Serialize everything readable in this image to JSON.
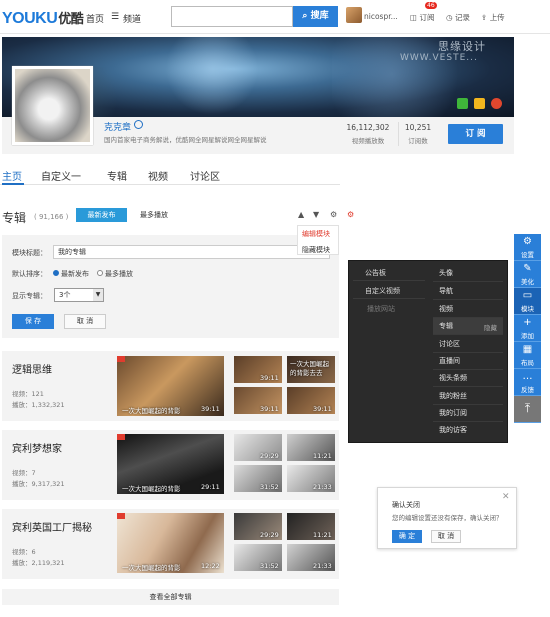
{
  "header": {
    "logo_en": "YOUKU",
    "logo_cn": "优酷",
    "nav_home": "首页",
    "nav_channel": "频道",
    "search_button": "搜库",
    "user_name": "nicospr...",
    "badge_count": "46",
    "link_subscribe": "订阅",
    "link_history": "记录",
    "link_upload": "上传",
    "menu_icon": "menu-icon",
    "upload_icon": "upload-icon"
  },
  "banner": {
    "watermark_cn": "思缘设计",
    "watermark_en": "WWW.VESTE..."
  },
  "profile": {
    "name": "克克章",
    "description": "国内首家电子商务解说，优酷网全网星解说网全网星解说",
    "views_value": "16,112,302",
    "views_label": "视频播放数",
    "subs_value": "10,251",
    "subs_label": "订阅数",
    "follow_button": "订 阅"
  },
  "tabs": [
    "主页",
    "自定义一",
    "专辑",
    "视频",
    "讨论区"
  ],
  "section": {
    "title": "专辑",
    "count": "( 91,166 )",
    "btn_newest": "最新发布",
    "btn_most": "最多播放",
    "ctl_up": "▲",
    "ctl_down": "▼",
    "ctl_gear": "⚙",
    "mini_menu_edit": "编辑模块",
    "mini_menu_hide": "隐藏模块"
  },
  "form": {
    "title_label": "模块标题：",
    "title_value": "我的专辑",
    "sort_label": "默认排序：",
    "sort_opt1": "最新发布",
    "sort_opt2": "最多播放",
    "show_label": "显示专辑：",
    "show_value": "3个",
    "save": "保 存",
    "cancel": "取 消"
  },
  "albums": [
    {
      "name": "逻辑思维",
      "videos": "视频：121",
      "plays": "播放：1,332,321",
      "big_caption": "一次大国崛起的背影",
      "big_dur": "39:11",
      "small": [
        {
          "dur": "39:11",
          "cap": ""
        },
        {
          "dur": "",
          "cap": "一次大国崛起的背影去去"
        },
        {
          "dur": "39:11",
          "cap": ""
        },
        {
          "dur": "39:11",
          "cap": ""
        }
      ]
    },
    {
      "name": "宾利梦想家",
      "videos": "视频：7",
      "plays": "播放：9,317,321",
      "big_caption": "一次大国崛起的背影",
      "big_dur": "29:11",
      "small": [
        {
          "dur": "29:29",
          "cap": ""
        },
        {
          "dur": "11:21",
          "cap": ""
        },
        {
          "dur": "31:52",
          "cap": ""
        },
        {
          "dur": "21:33",
          "cap": ""
        }
      ]
    },
    {
      "name": "宾利英国工厂揭秘",
      "videos": "视频：6",
      "plays": "播放：2,119,321",
      "big_caption": "一次大国崛起的背影",
      "big_dur": "12:22",
      "small": [
        {
          "dur": "29:29",
          "cap": ""
        },
        {
          "dur": "11:21",
          "cap": ""
        },
        {
          "dur": "31:52",
          "cap": ""
        },
        {
          "dur": "21:33",
          "cap": ""
        }
      ]
    }
  ],
  "view_all": "查看全部专辑",
  "dark_menu": {
    "left": [
      "公告板",
      "自定义视频",
      "播放网站"
    ],
    "right": [
      "头像",
      "导航",
      "视频",
      "专辑",
      "讨论区",
      "直播间",
      "视头条频",
      "我的粉丝",
      "我的订阅",
      "我的访客"
    ],
    "hide_label": "隐藏"
  },
  "right_toolbar": [
    {
      "label": "设置",
      "icon": "⚙"
    },
    {
      "label": "美化",
      "icon": "✎"
    },
    {
      "label": "模块",
      "icon": "▭"
    },
    {
      "label": "添加",
      "icon": "+"
    },
    {
      "label": "布局",
      "icon": "▦"
    },
    {
      "label": "反馈",
      "icon": "…"
    },
    {
      "label": "",
      "icon": "⤒"
    }
  ],
  "dialog": {
    "title": "确认关闭",
    "text": "您的编辑设置还没有保存，确认关闭？",
    "ok": "确 定",
    "cancel": "取 消",
    "close": "✕"
  }
}
